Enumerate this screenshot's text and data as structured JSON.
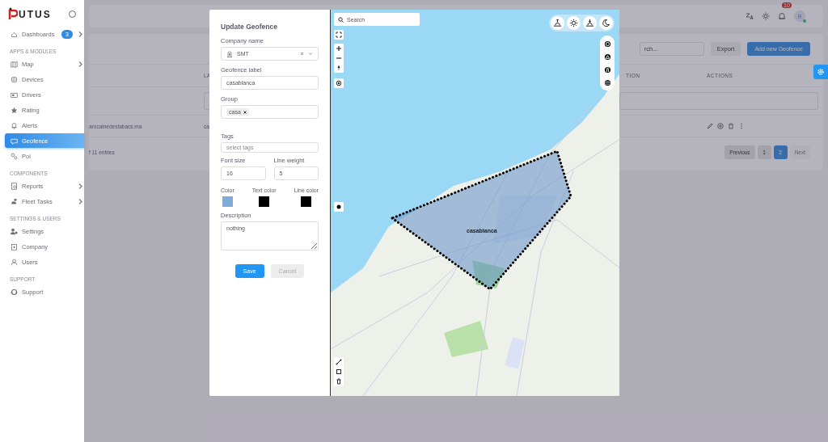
{
  "sidebar": {
    "logo": "UTUS",
    "items": [
      {
        "kind": "item",
        "label": "Dashboards",
        "badge": "3",
        "has_submenu": true,
        "selected": false
      },
      {
        "kind": "section",
        "label": "APPS & MODULES"
      },
      {
        "kind": "item",
        "label": "Map",
        "has_submenu": true,
        "selected": false
      },
      {
        "kind": "item",
        "label": "Devices",
        "has_submenu": false,
        "selected": false
      },
      {
        "kind": "item",
        "label": "Drivers",
        "has_submenu": false,
        "selected": false
      },
      {
        "kind": "item",
        "label": "Rating",
        "has_submenu": false,
        "selected": false
      },
      {
        "kind": "item",
        "label": "Alerts",
        "has_submenu": false,
        "selected": false
      },
      {
        "kind": "item",
        "label": "Geofence",
        "has_submenu": false,
        "selected": true
      },
      {
        "kind": "item",
        "label": "Poi",
        "has_submenu": false,
        "selected": false
      },
      {
        "kind": "section",
        "label": "COMPONENTS"
      },
      {
        "kind": "item",
        "label": "Reports",
        "has_submenu": true,
        "selected": false
      },
      {
        "kind": "item",
        "label": "Fleet Tasks",
        "has_submenu": true,
        "selected": false
      },
      {
        "kind": "section",
        "label": "SETTINGS & USERS"
      },
      {
        "kind": "item",
        "label": "Settings",
        "has_submenu": false,
        "selected": false
      },
      {
        "kind": "item",
        "label": "Company",
        "has_submenu": false,
        "selected": false
      },
      {
        "kind": "item",
        "label": "Users",
        "has_submenu": false,
        "selected": false
      },
      {
        "kind": "section",
        "label": "SUPPORT"
      },
      {
        "kind": "item",
        "label": "Support",
        "has_submenu": false,
        "selected": false
      }
    ]
  },
  "header": {
    "notification_count": "10",
    "avatar_initial": "R"
  },
  "toolbar": {
    "search_placeholder": "rch...",
    "export_label": "Export",
    "add_label": "Add new Geofence"
  },
  "table": {
    "columns": [
      "LA",
      "TION",
      "ACTIONS"
    ],
    "rows": [
      {
        "column_1": "arocainedestabacs.ma",
        "column_2": "ca"
      }
    ],
    "footer": "f 11 entries",
    "pagination": [
      {
        "label": "Previous",
        "selected": false,
        "disabled": false
      },
      {
        "label": "1",
        "selected": false,
        "disabled": false
      },
      {
        "label": "2",
        "selected": true,
        "disabled": false
      },
      {
        "label": "Next",
        "selected": false,
        "disabled": true
      }
    ]
  },
  "modal": {
    "title": "Update Geofence",
    "company": {
      "label": "Company name",
      "value": "SMT"
    },
    "geofence_label": {
      "label": "Geofence label",
      "value": "casablanca"
    },
    "group": {
      "label": "Group",
      "chips": [
        "casa"
      ]
    },
    "tags": {
      "label": "Tags",
      "placeholder": "select tags"
    },
    "font_size": {
      "label": "Font size",
      "value": "16"
    },
    "line_weight": {
      "label": "Line weight",
      "value": "5"
    },
    "colors": [
      {
        "label": "Color",
        "color": "#7eabd8"
      },
      {
        "label": "Text color",
        "color": "#000000"
      },
      {
        "label": "Line color",
        "color": "#000000"
      }
    ],
    "description": {
      "label": "Description",
      "value": "nothing"
    },
    "buttons": [
      {
        "label": "Save",
        "disabled": false
      },
      {
        "label": "Cancel",
        "disabled": true
      }
    ]
  },
  "map": {
    "search_placeholder": "Search",
    "polygon_label": "casablanca"
  }
}
